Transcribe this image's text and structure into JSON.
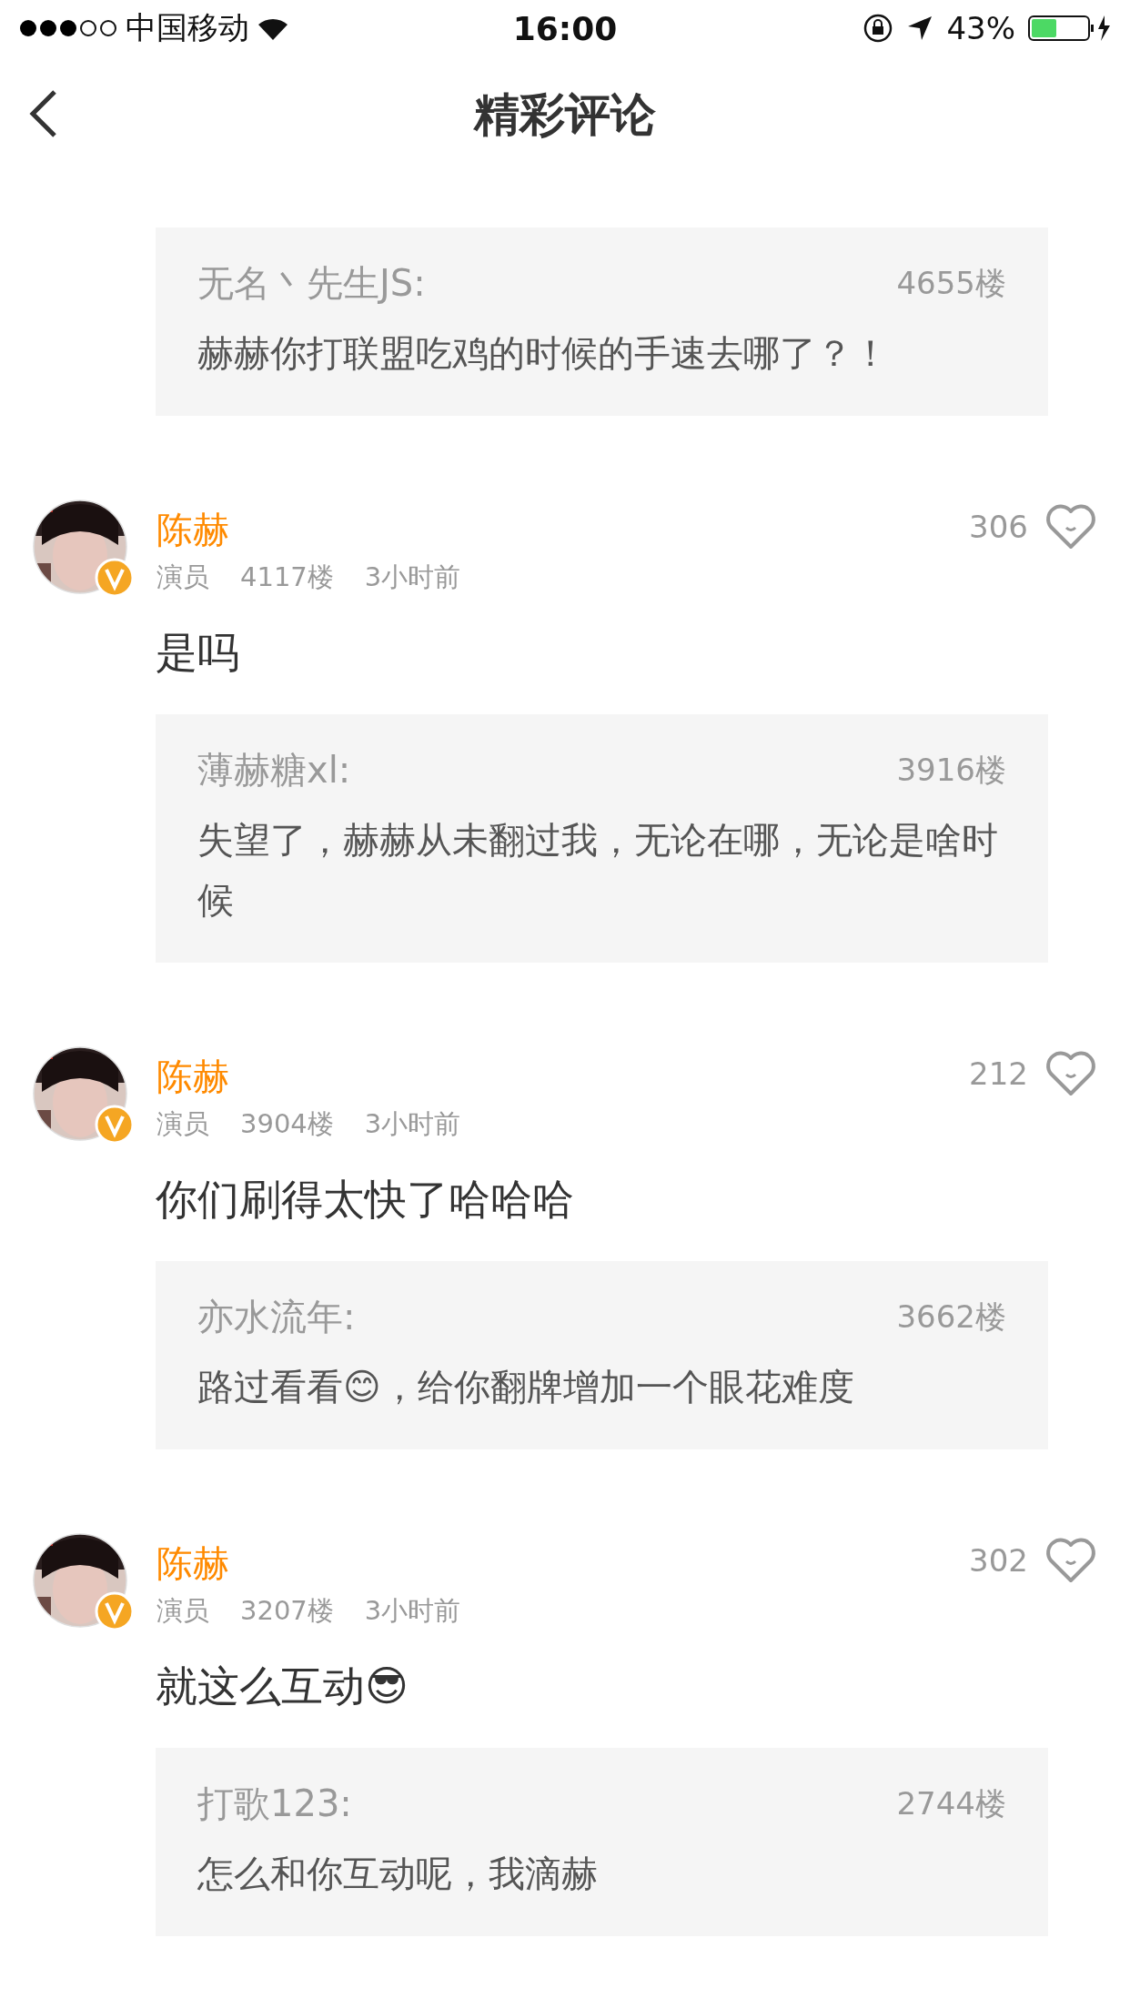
{
  "status_bar": {
    "carrier": "中国移动",
    "time": "16:00",
    "battery": "43%"
  },
  "nav": {
    "title": "精彩评论"
  },
  "comments": [
    {
      "reply": {
        "user": "无名丶先生JS:",
        "floor": "4655楼",
        "text": "赫赫你打联盟吃鸡的时候的手速去哪了？！"
      }
    },
    {
      "name": "陈赫",
      "role": "演员",
      "floor": "4117楼",
      "time": "3小时前",
      "likes": "306",
      "text": "是吗",
      "reply": {
        "user": "薄赫糖xl:",
        "floor": "3916楼",
        "text": "失望了，赫赫从未翻过我，无论在哪，无论是啥时候"
      }
    },
    {
      "name": "陈赫",
      "role": "演员",
      "floor": "3904楼",
      "time": "3小时前",
      "likes": "212",
      "text": "你们刷得太快了哈哈哈",
      "reply": {
        "user": "亦水流年:",
        "floor": "3662楼",
        "text": "路过看看😊，给你翻牌增加一个眼花难度"
      }
    },
    {
      "name": "陈赫",
      "role": "演员",
      "floor": "3207楼",
      "time": "3小时前",
      "likes": "302",
      "text": "就这么互动😎",
      "reply": {
        "user": "打歌123:",
        "floor": "2744楼",
        "text": "怎么和你互动呢，我滴赫"
      }
    }
  ]
}
